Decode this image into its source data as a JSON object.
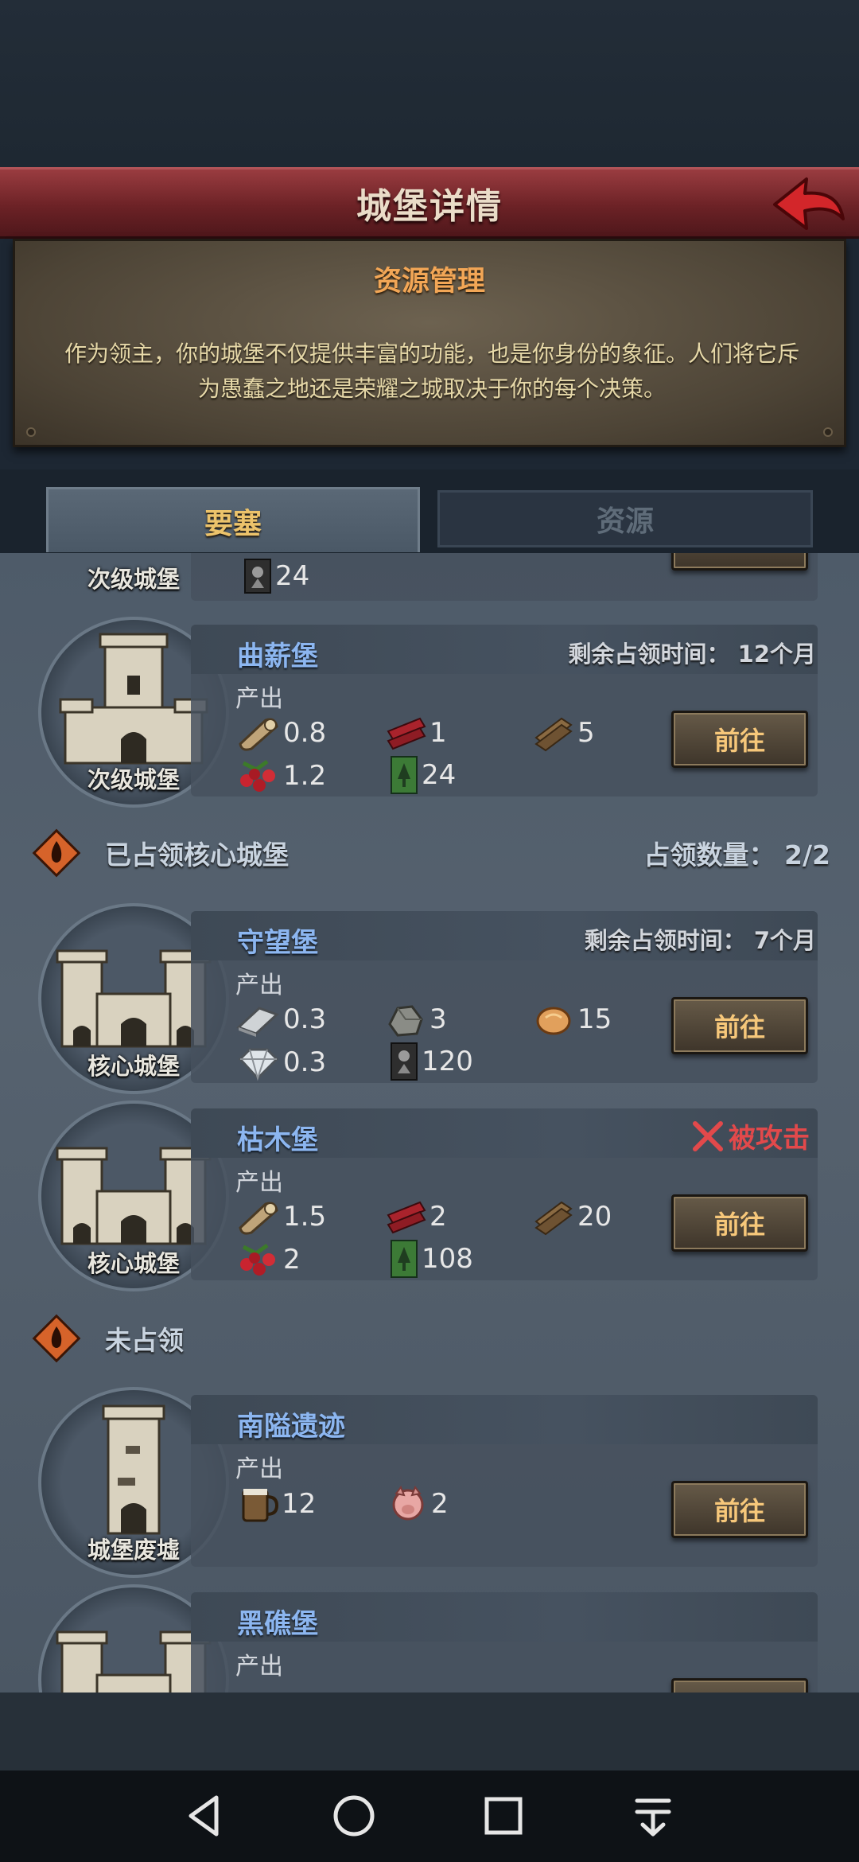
{
  "header": {
    "title": "城堡详情"
  },
  "info": {
    "title": "资源管理",
    "description": "作为领主，你的城堡不仅提供丰富的功能，也是你身份的象征。人们将它斥为愚蠢之地还是荣耀之城取决于你的每个决策。"
  },
  "tabs": [
    {
      "label": "要塞",
      "active": true
    },
    {
      "label": "资源",
      "active": false
    }
  ],
  "colors": {
    "accent": "#ecc36b",
    "name": "#8cb6f0",
    "alert": "#e2494b",
    "header": "#6c2226"
  },
  "partial_top": {
    "type_label": "次级城堡",
    "value": "24"
  },
  "sections": {
    "core": {
      "title": "已占领核心城堡",
      "count_label": "占领数量：",
      "count": "2/2"
    },
    "unoccupied": {
      "title": "未占领"
    }
  },
  "castles": [
    {
      "name": "曲薪堡",
      "type_label": "次级城堡",
      "status": "剩余占领时间：",
      "time": "12个月",
      "output_label": "产出",
      "button": "前往",
      "resources": [
        {
          "icon": "wood-log-icon",
          "value": "0.8"
        },
        {
          "icon": "red-plank-icon",
          "value": "1"
        },
        {
          "icon": "wood-board-icon",
          "value": "5"
        },
        {
          "icon": "berries-icon",
          "value": "1.2"
        },
        {
          "icon": "green-banner-icon",
          "value": "24"
        }
      ]
    },
    {
      "name": "守望堡",
      "type_label": "核心城堡",
      "status": "剩余占领时间：",
      "time": "7个月",
      "output_label": "产出",
      "button": "前往",
      "resources": [
        {
          "icon": "iron-ingot-icon",
          "value": "0.3"
        },
        {
          "icon": "stone-ore-icon",
          "value": "3"
        },
        {
          "icon": "bread-icon",
          "value": "15"
        },
        {
          "icon": "diamond-icon",
          "value": "0.3"
        },
        {
          "icon": "dark-banner-icon",
          "value": "120"
        }
      ]
    },
    {
      "name": "枯木堡",
      "type_label": "核心城堡",
      "status": "被攻击",
      "output_label": "产出",
      "button": "前往",
      "resources": [
        {
          "icon": "wood-log-icon",
          "value": "1.5"
        },
        {
          "icon": "red-plank-icon",
          "value": "2"
        },
        {
          "icon": "wood-board-icon",
          "value": "20"
        },
        {
          "icon": "berries-icon",
          "value": "2"
        },
        {
          "icon": "green-banner-icon",
          "value": "108"
        }
      ]
    },
    {
      "name": "南隘遗迹",
      "type_label": "城堡废墟",
      "output_label": "产出",
      "button": "前往",
      "resources": [
        {
          "icon": "ale-mug-icon",
          "value": "12"
        },
        {
          "icon": "pig-icon",
          "value": "2"
        }
      ]
    },
    {
      "name": "黑礁堡",
      "output_label": "产出"
    }
  ]
}
